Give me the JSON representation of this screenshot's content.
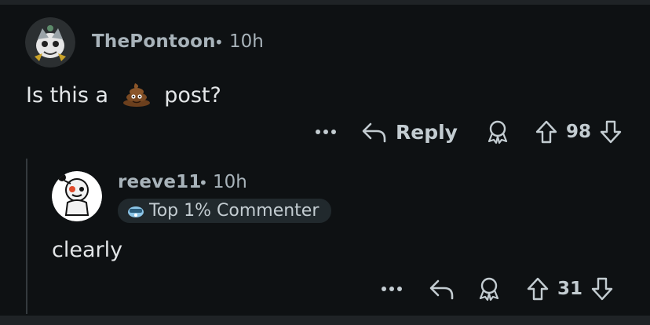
{
  "comments": [
    {
      "author": "ThePontoon",
      "separator": "•",
      "time": "10h",
      "text_before": "Is this a",
      "emoji": "💩",
      "text_after": "post?",
      "actions": {
        "more": "•••",
        "reply_label": "Reply",
        "score": "98"
      }
    },
    {
      "author": "reeve11",
      "separator": "•",
      "time": "10h",
      "flair": "Top 1% Commenter",
      "text": "clearly",
      "actions": {
        "more": "•••",
        "score": "31"
      }
    }
  ],
  "colors": {
    "background": "#0e1113",
    "text": "#e3e6e8",
    "meta": "#a8b3ba",
    "action": "#c3ccd1"
  }
}
